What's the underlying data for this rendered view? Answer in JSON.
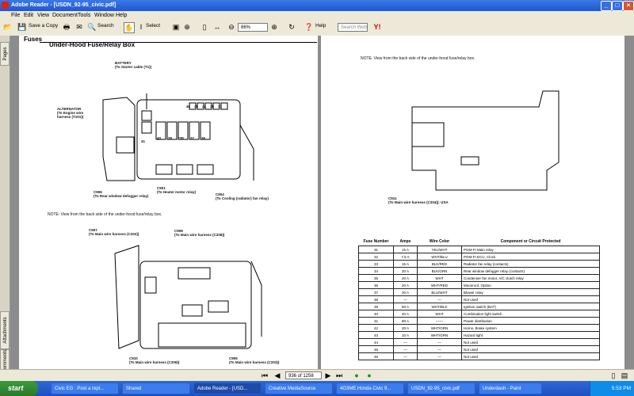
{
  "window": {
    "title": "Adobe Reader - [USDN_92-95_civic.pdf]"
  },
  "menu": [
    "File",
    "Edit",
    "View",
    "Document",
    "Tools",
    "Window",
    "Help"
  ],
  "toolbar": {
    "save_copy": "Save a Copy",
    "search": "Search",
    "select": "Select",
    "zoom_value": "86%",
    "help": "Help",
    "search_web_placeholder": "Search Web"
  },
  "sidebar": {
    "tabs": [
      "Pages",
      "Attachments",
      "Comments"
    ]
  },
  "left_page": {
    "header": "Fuses",
    "title": "Under-Hood Fuse/Relay Box",
    "labels": {
      "battery": "BATTERY\n(To Starter cable (T1))",
      "alternator": "ALTERNATOR\n(To Engine wire\nharness (T101))",
      "c906": "C906\n(To Rear window defogger relay)",
      "c901": "C901\n(To Heater motor relay)",
      "c904": "C904\n(To Cooling (radiator) fan relay)",
      "c907": "C907\n(To Main wire harness (C202))",
      "c908": "C908\n(To Main wire harness (C208))",
      "c910": "C910\n(To Main wire harness (C209))",
      "c905": "C905\n(To Main wire harness (C203))"
    },
    "fuse_numbers": [
      "41",
      "46",
      "45",
      "44",
      "35",
      "31",
      "32",
      "33",
      "34",
      "40",
      "39",
      "*38",
      "37",
      "36"
    ],
    "note": "NOTE:  View from the back side of the under-hood fuse/relay box."
  },
  "right_page": {
    "note": "NOTE:  View from the back side of the under-hood fuse/relay box.",
    "c911": "C911\n(To Main wire harness (C204)): USA",
    "table": {
      "headers": [
        "Fuse Number",
        "Amps",
        "Wire Color",
        "Component or Circuit Protected"
      ],
      "rows": [
        [
          "31",
          "15 A",
          "YEL/WHT",
          "PGM-FI Main relay"
        ],
        [
          "32",
          "7.5 A",
          "WHT/BLU",
          "PGM-FI ECU, Clock"
        ],
        [
          "33",
          "15 A",
          "BLK/RED",
          "Radiator fan relay (contacts)"
        ],
        [
          "34",
          "20 A",
          "BLK/GRN",
          "Rear window defogger relay (contacts)"
        ],
        [
          "35",
          "20 A",
          "WHT",
          "Condenser fan motor, A/C clutch relay"
        ],
        [
          "36",
          "20 A",
          "WHT/RED",
          "Moonroof, Option"
        ],
        [
          "37",
          "30 A",
          "BLU/WHT",
          "Blower relay"
        ],
        [
          "38",
          "—",
          "—",
          "Not used"
        ],
        [
          "39",
          "50 A",
          "WHT/BLK",
          "Ignition switch (BAT)"
        ],
        [
          "40",
          "40 A",
          "WHT",
          "Combination light switch"
        ],
        [
          "41",
          "80 A",
          "——",
          "Power distribution"
        ],
        [
          "42",
          "20 A",
          "WHT/GRN",
          "Horns, Brake system"
        ],
        [
          "43",
          "10 A",
          "WHT/GRN",
          "Hazard light"
        ],
        [
          "44",
          "—",
          "—",
          "Not used"
        ],
        [
          "45",
          "—",
          "—",
          "Not used"
        ],
        [
          "46",
          "—",
          "—",
          "Not used"
        ]
      ]
    }
  },
  "status": {
    "page_indicator": "936 of 1258"
  },
  "taskbar": {
    "start": "start",
    "tasks": [
      "Civic EG : Post a repl...",
      "Shared",
      "Adobe Reader - [USD...",
      "Creative MediaSource",
      "4G3ME.Honda Civic 9...",
      "USDN_92-95_civic.pdf",
      "Underdash - Paint"
    ],
    "clock": "5:53 PM"
  },
  "colors": {
    "titlebar": "#1f57d0",
    "taskbar": "#1d4fc2",
    "start": "#2c7a2c"
  }
}
